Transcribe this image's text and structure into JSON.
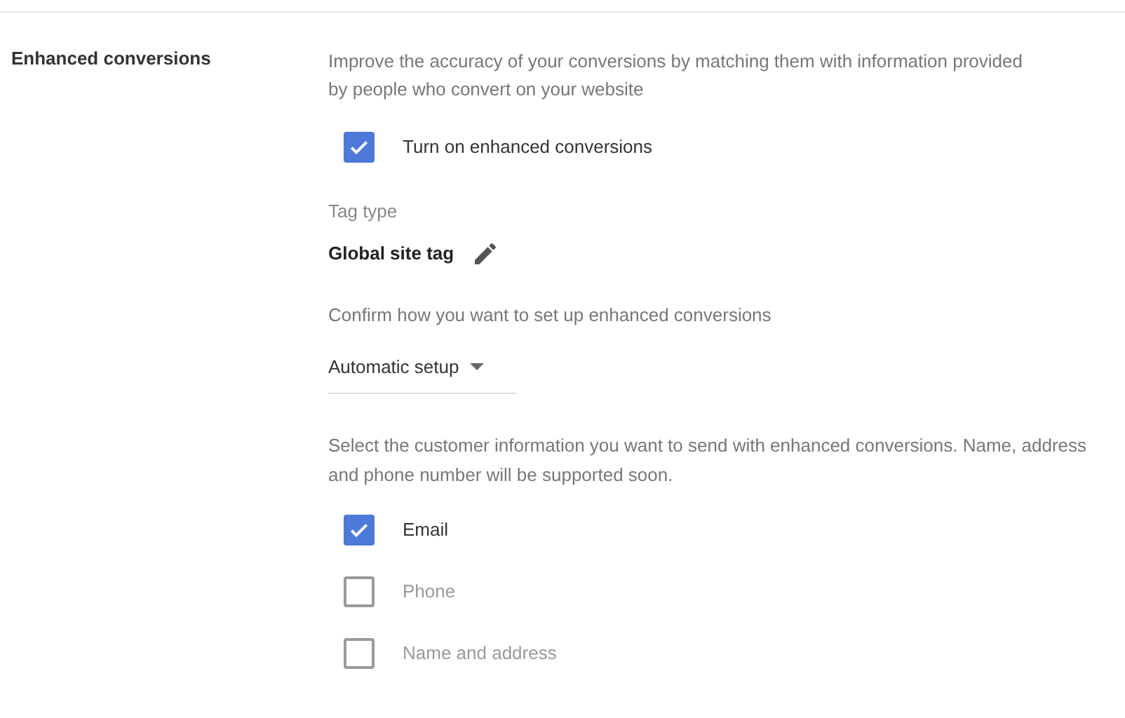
{
  "section": {
    "title": "Enhanced conversions",
    "description": "Improve the accuracy of your conversions by matching them with information provided by people who convert on your website"
  },
  "enable": {
    "label": "Turn on enhanced conversions",
    "checked": true
  },
  "tag_type": {
    "label": "Tag type",
    "value": "Global site tag"
  },
  "setup": {
    "prompt": "Confirm how you want to set up enhanced conversions",
    "value": "Automatic setup"
  },
  "info": {
    "prompt": "Select the customer information you want to send with enhanced conversions. Name, address and phone number will be supported soon.",
    "options": [
      {
        "label": "Email",
        "checked": true
      },
      {
        "label": "Phone",
        "checked": false
      },
      {
        "label": "Name and address",
        "checked": false
      }
    ]
  }
}
